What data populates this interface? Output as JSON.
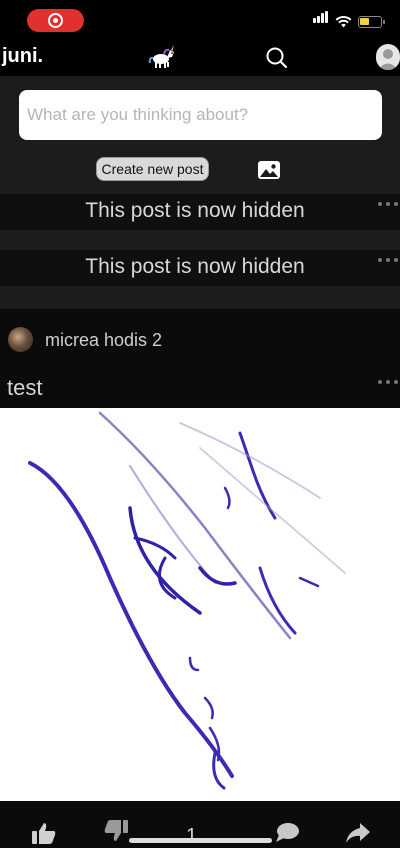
{
  "status_bar": {
    "recording_icon": "screen-record-icon",
    "signal_icon": "cellular-signal-icon",
    "wifi_icon": "wifi-icon",
    "battery_icon": "battery-low-icon"
  },
  "app_bar": {
    "brand": "juni.",
    "logo_icon": "unicorn-icon",
    "search_icon": "search-icon",
    "avatar_icon": "user-avatar-icon"
  },
  "composer": {
    "placeholder": "What are you thinking about?",
    "create_label": "Create new post",
    "image_icon": "image-upload-icon"
  },
  "hidden_posts": [
    {
      "text": "This post is now hidden",
      "more_icon": "more-options-icon"
    },
    {
      "text": "This post is now hidden",
      "more_icon": "more-options-icon"
    }
  ],
  "post": {
    "author": "micrea hodis 2",
    "title": "test",
    "image_alt": "handwritten signature drawing",
    "more_icon": "more-options-icon",
    "actions": {
      "like_icon": "thumbs-up-icon",
      "dislike_icon": "thumbs-down-icon",
      "score": "1",
      "comment_icon": "comment-icon",
      "share_icon": "share-icon"
    }
  },
  "colors": {
    "record": "#e0312f",
    "battery": "#f4d03f",
    "background": "#000000",
    "panel": "#1c1c1e"
  }
}
